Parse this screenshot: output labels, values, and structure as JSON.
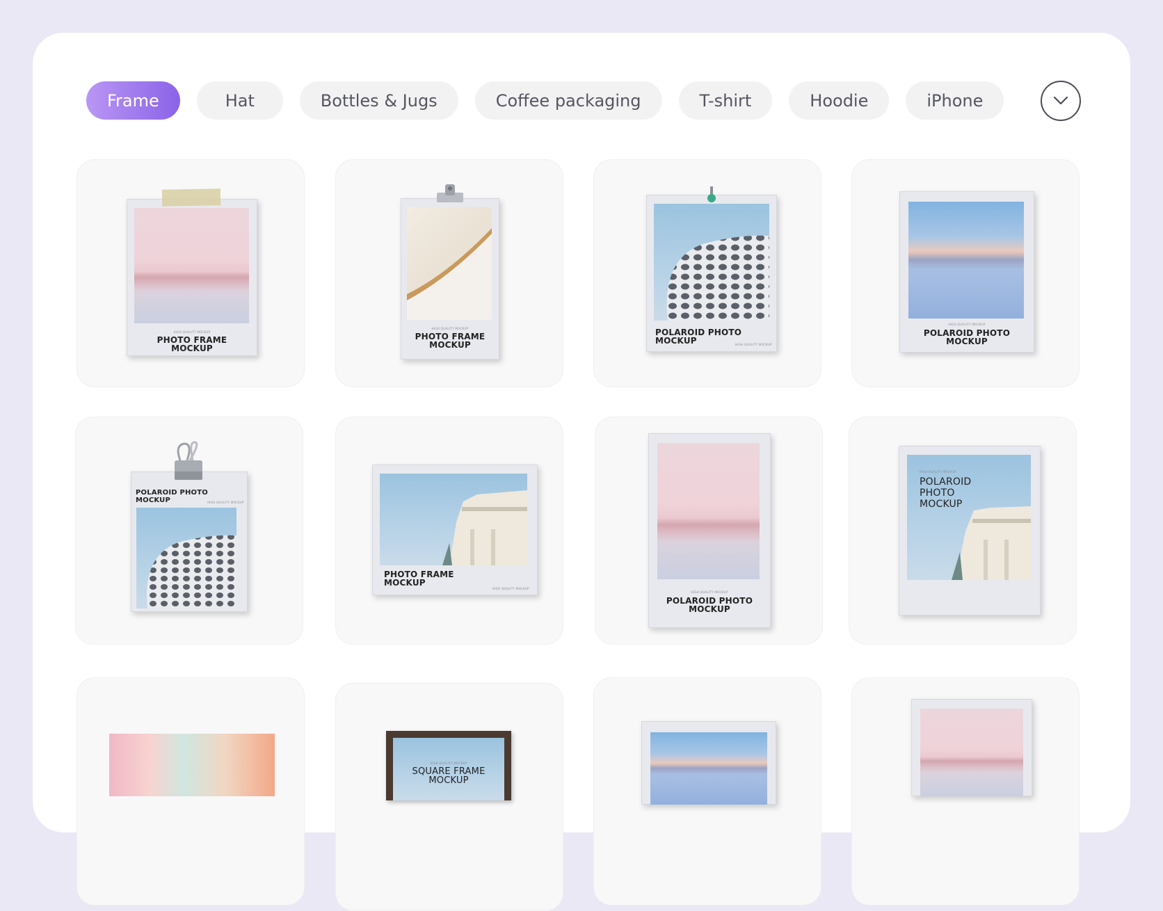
{
  "categories": {
    "items": [
      {
        "label": "Frame",
        "active": true
      },
      {
        "label": "Hat",
        "active": false
      },
      {
        "label": "Bottles & Jugs",
        "active": false
      },
      {
        "label": "Coffee packaging",
        "active": false
      },
      {
        "label": "T-shirt",
        "active": false
      },
      {
        "label": "Hoodie",
        "active": false
      },
      {
        "label": "iPhone",
        "active": false
      }
    ],
    "more_icon": "chevron-down-icon"
  },
  "mockups": [
    {
      "title": "PHOTO FRAME\nMOCKUP",
      "subtitle": "HIGH QUALITY MOCKUP",
      "attachment": "tape"
    },
    {
      "title": "PHOTO FRAME\nMOCKUP",
      "subtitle": "HIGH QUALITY MOCKUP",
      "attachment": "clip"
    },
    {
      "title": "POLAROID PHOTO\nMOCKUP",
      "subtitle": "HIGH QUALITY MOCKUP",
      "attachment": "pin"
    },
    {
      "title": "POLAROID PHOTO\nMOCKUP",
      "subtitle": "HIGH QUALITY MOCKUP",
      "attachment": "none"
    },
    {
      "title": "POLAROID PHOTO\nMOCKUP",
      "subtitle": "HIGH QUALITY MOCKUP",
      "attachment": "binder-clip"
    },
    {
      "title": "PHOTO FRAME\nMOCKUP",
      "subtitle": "HIGH QUALITY MOCKUP",
      "attachment": "none"
    },
    {
      "title": "POLAROID PHOTO\nMOCKUP",
      "subtitle": "HIGH QUALITY MOCKUP",
      "attachment": "none"
    },
    {
      "title": "POLAROID\nPHOTO\nMOCKUP",
      "subtitle": "HIGH QUALITY MOCKUP",
      "attachment": "none"
    },
    {
      "title": "",
      "subtitle": "",
      "attachment": "none"
    },
    {
      "title": "SQUARE FRAME\nMOCKUP",
      "subtitle": "HIGH QUALITY MOCKUP",
      "attachment": "wood-frame"
    },
    {
      "title": "",
      "subtitle": "",
      "attachment": "none"
    },
    {
      "title": "",
      "subtitle": "",
      "attachment": "none"
    }
  ],
  "colors": {
    "page_bg": "#e9e8f4",
    "accent_start": "#b996f4",
    "accent_end": "#8a63e8",
    "chip_bg": "#f2f2f3",
    "card_bg": "#f8f8f9"
  }
}
